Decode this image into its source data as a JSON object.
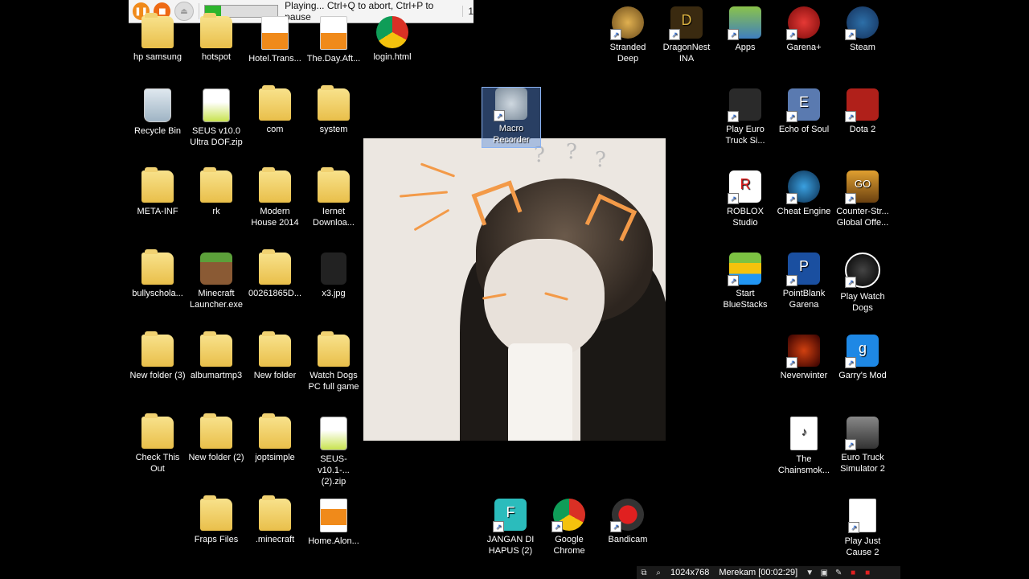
{
  "macro_toolbar": {
    "status": "Playing... Ctrl+Q to abort, Ctrl+P to pause",
    "repeat_count": "1",
    "progress_fraction": 0.22,
    "colors": {
      "pause": "#f08a1a",
      "stop": "#ee6a14",
      "progress": "#2db52d"
    }
  },
  "icons": {
    "hp_samsung": "hp samsung",
    "hotspot": "hotspot",
    "hotel": "Hotel.Trans...",
    "theday": "The.Day.Aft...",
    "login": "login.html",
    "stranded": "Stranded Deep",
    "dragonnest": "DragonNest INA",
    "apps": "Apps",
    "garena": "Garena+",
    "steam": "Steam",
    "recycle": "Recycle Bin",
    "seus10": "SEUS v10.0 Ultra DOF.zip",
    "com": "com",
    "system": "system",
    "macro": "Macro Recorder",
    "euro_play": "Play Euro Truck Si...",
    "echo": "Echo of Soul",
    "dota": "Dota 2",
    "metainf": "META-INF",
    "rk": "rk",
    "modern": "Modern House 2014",
    "iernet": "Iernet Downloa...",
    "roblox": "ROBLOX Studio",
    "cheat": "Cheat Engine",
    "csgo": "Counter-Str... Global Offe...",
    "bully": "bullyschola...",
    "minecraft": "Minecraft Launcher.exe",
    "n00261865": "00261865D...",
    "x3": "x3.jpg",
    "bluestacks": "Start BlueStacks",
    "pointblank": "PointBlank Garena",
    "watchdogs_play": "Play Watch Dogs",
    "newfolder3": "New folder (3)",
    "albumart": "albumartmp3",
    "newfolder": "New folder",
    "watchdogs_full": "Watch Dogs PC full game",
    "neverwinter": "Neverwinter",
    "garrys": "Garry's Mod",
    "checkthis": "Check This Out",
    "newfolder2": "New folder (2)",
    "joptsimple": "joptsimple",
    "seus101": "SEUS-v10.1-... (2).zip",
    "chainsmok": "The Chainsmok...",
    "eurotruck2": "Euro Truck Simulator 2",
    "fraps": "Fraps Files",
    "dotminecraft": ".minecraft",
    "homealone": "Home.Alon...",
    "jangan": "JANGAN DI HAPUS (2)",
    "chrome": "Google Chrome",
    "bandicam": "Bandicam",
    "justcause": "Play Just Cause 2"
  },
  "bandicam_bar": {
    "resolution": "1024x768",
    "recording": "Merekam [00:02:29]"
  }
}
